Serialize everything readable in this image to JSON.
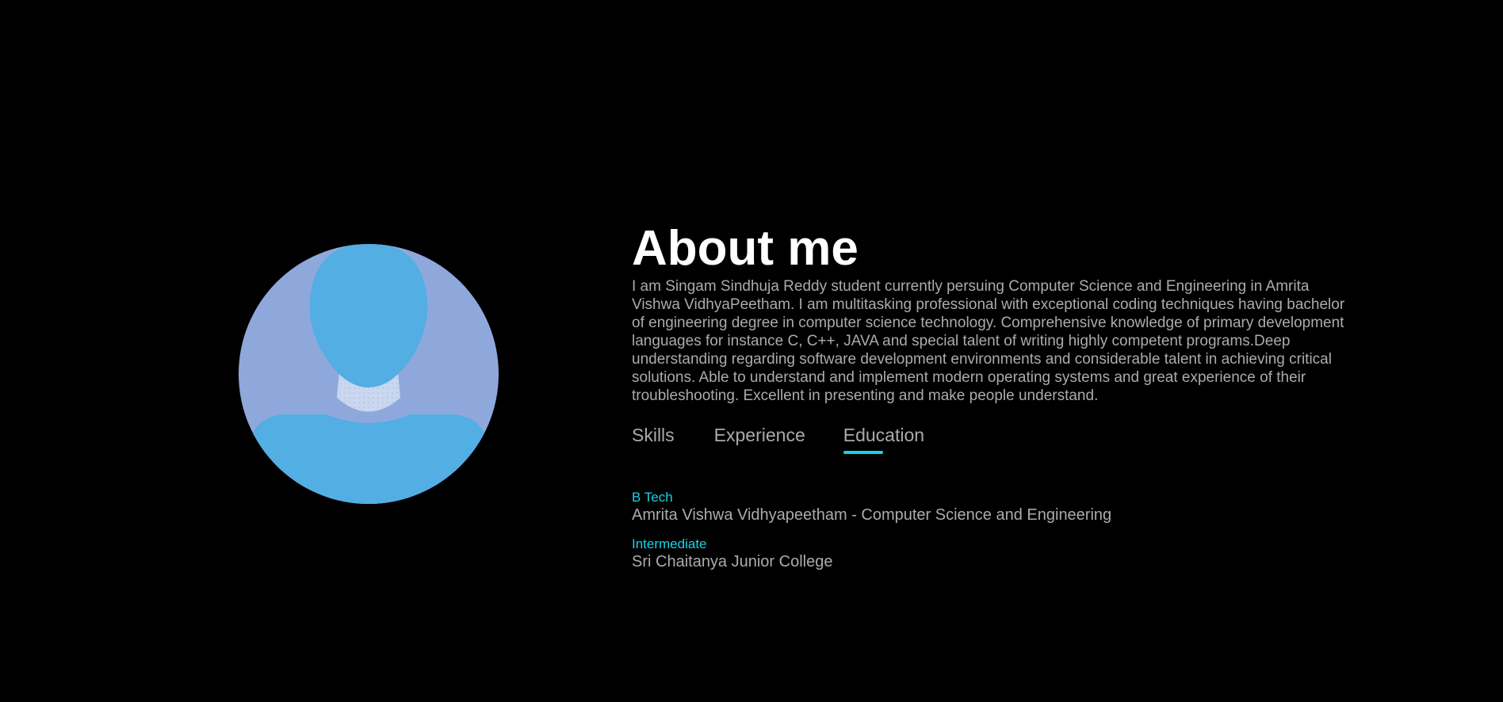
{
  "about": {
    "title": "About me",
    "bio": "I am Singam Sindhuja Reddy student currently persuing Computer Science and Engineering in Amrita Vishwa VidhyaPeetham. I am multitasking professional with exceptional coding techniques having bachelor of engineering degree in computer science technology. Comprehensive knowledge of primary development languages for instance C, C++, JAVA and special talent of writing highly competent programs.Deep understanding regarding software development environments and considerable talent in achieving critical solutions. Able to understand and implement modern operating systems and great experience of their troubleshooting. Excellent in presenting and make people understand."
  },
  "tabs": [
    {
      "label": "Skills",
      "active": false
    },
    {
      "label": "Experience",
      "active": false
    },
    {
      "label": "Education",
      "active": true
    }
  ],
  "education": [
    {
      "degree": "B Tech",
      "school": "Amrita Vishwa Vidhyapeetham - Computer Science and Engineering"
    },
    {
      "degree": "Intermediate",
      "school": "Sri Chaitanya Junior College"
    }
  ],
  "avatar": {
    "icon": "default-user-avatar-icon",
    "circle_color": "#8fa8dc",
    "figure_color": "#52aee3",
    "neck_color": "#c9d7ef"
  },
  "colors": {
    "background": "#000000",
    "title": "#ffffff",
    "text": "#ababab",
    "accent": "#19d2e6"
  }
}
